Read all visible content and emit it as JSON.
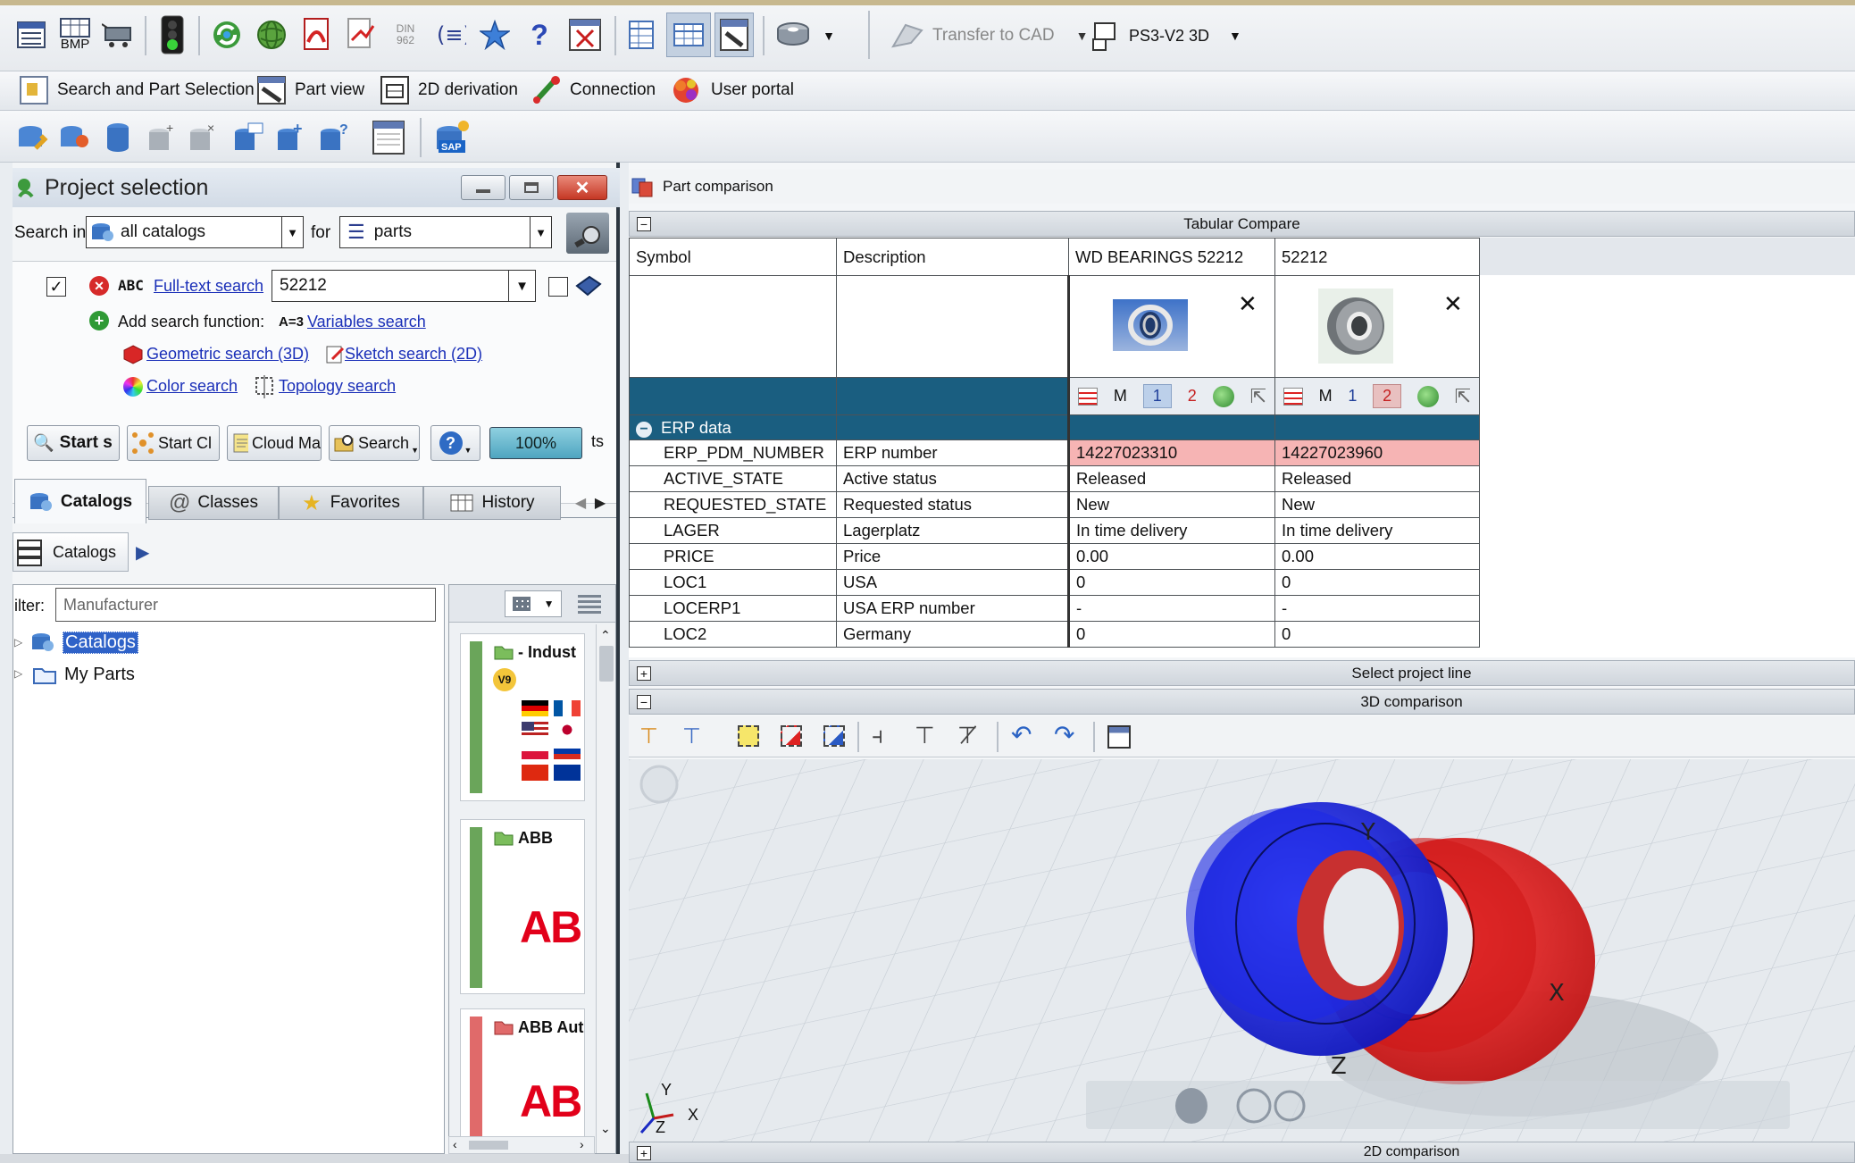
{
  "toolbar_top": {
    "icons": [
      "list-icon",
      "bmp-icon",
      "cart-icon",
      "traffic-light-icon",
      "refresh-icon",
      "globe-icon",
      "pdf-icon",
      "export-icon",
      "din-icon",
      "equals-icon",
      "star-icon",
      "help-icon",
      "close-box-icon",
      "table-icon",
      "table-view-icon",
      "part-view-icon",
      "part-icon",
      "dropdown-icon"
    ],
    "bmp_label": "BMP",
    "din_label": "DIN 962",
    "transfer_cad": "Transfer to CAD",
    "ps3_label": "PS3-V2 3D"
  },
  "toolbar_nav": {
    "items": [
      "Search and Part Selection",
      "Part view",
      "2D derivation",
      "Connection",
      "User portal"
    ]
  },
  "project_selection": {
    "title": "Project selection",
    "search_in_label": "Search in",
    "search_in_value": "all catalogs",
    "for_label": "for",
    "for_value": "parts",
    "fulltext_prefix": "ABC",
    "fulltext_link": "Full-text search",
    "fulltext_value": "52212",
    "add_search_label": "Add search function:",
    "variables_prefix": "A=3",
    "variables_link": "Variables search",
    "geometric_link": "Geometric search (3D)",
    "sketch_link": "Sketch search (2D)",
    "color_link": "Color search",
    "topology_link": "Topology search",
    "buttons": [
      "Start s",
      "Start Cl",
      "Cloud Ma",
      "Search",
      "?"
    ],
    "zoom": "100%",
    "ts": "ts",
    "tabs": [
      "Catalogs",
      "Classes",
      "Favorites",
      "History"
    ],
    "breadcrumb": "Catalogs",
    "filter_label": "ilter:",
    "filter_placeholder": "Manufacturer",
    "tree": [
      "Catalogs",
      "My Parts"
    ],
    "catalog_tiles": [
      {
        "name": "- Indust",
        "badge": "V9"
      },
      {
        "name": "ABB",
        "logo": "AB"
      },
      {
        "name": "ABB Aut",
        "logo": "AB"
      }
    ]
  },
  "part_comparison": {
    "title": "Part comparison",
    "tabular_compare": "Tabular Compare",
    "headers": [
      "Symbol",
      "Description",
      "WD BEARINGS 52212",
      "52212"
    ],
    "view_buttons": [
      "M",
      "1",
      "2"
    ],
    "section": "ERP data",
    "rows": [
      {
        "symbol": "ERP_PDM_NUMBER",
        "desc": "ERP number",
        "a": "14227023310",
        "b": "14227023960"
      },
      {
        "symbol": "ACTIVE_STATE",
        "desc": "Active status",
        "a": "Released",
        "b": "Released"
      },
      {
        "symbol": "REQUESTED_STATE",
        "desc": "Requested status",
        "a": "New",
        "b": "New"
      },
      {
        "symbol": "LAGER",
        "desc": "Lagerplatz",
        "a": "In time delivery",
        "b": "In time delivery"
      },
      {
        "symbol": "PRICE",
        "desc": "Price",
        "a": "0.00",
        "b": "0.00"
      },
      {
        "symbol": "LOC1",
        "desc": "USA",
        "a": "0",
        "b": "0"
      },
      {
        "symbol": "LOCERP1",
        "desc": "USA ERP number",
        "a": "-",
        "b": "-"
      },
      {
        "symbol": "LOC2",
        "desc": "Germany",
        "a": "0",
        "b": "0"
      }
    ],
    "select_project_line": "Select project line",
    "comparison_3d": "3D comparison",
    "comparison_2d": "2D comparison",
    "axis": {
      "y": "Y",
      "x": "X",
      "z": "Z"
    }
  },
  "colors": {
    "erp_header": "#1a5e80",
    "pink_cell": "#f6b4b4",
    "viewport_bg": "#e6eaee",
    "part_blue": "#1a24e0",
    "part_red": "#e01818"
  }
}
